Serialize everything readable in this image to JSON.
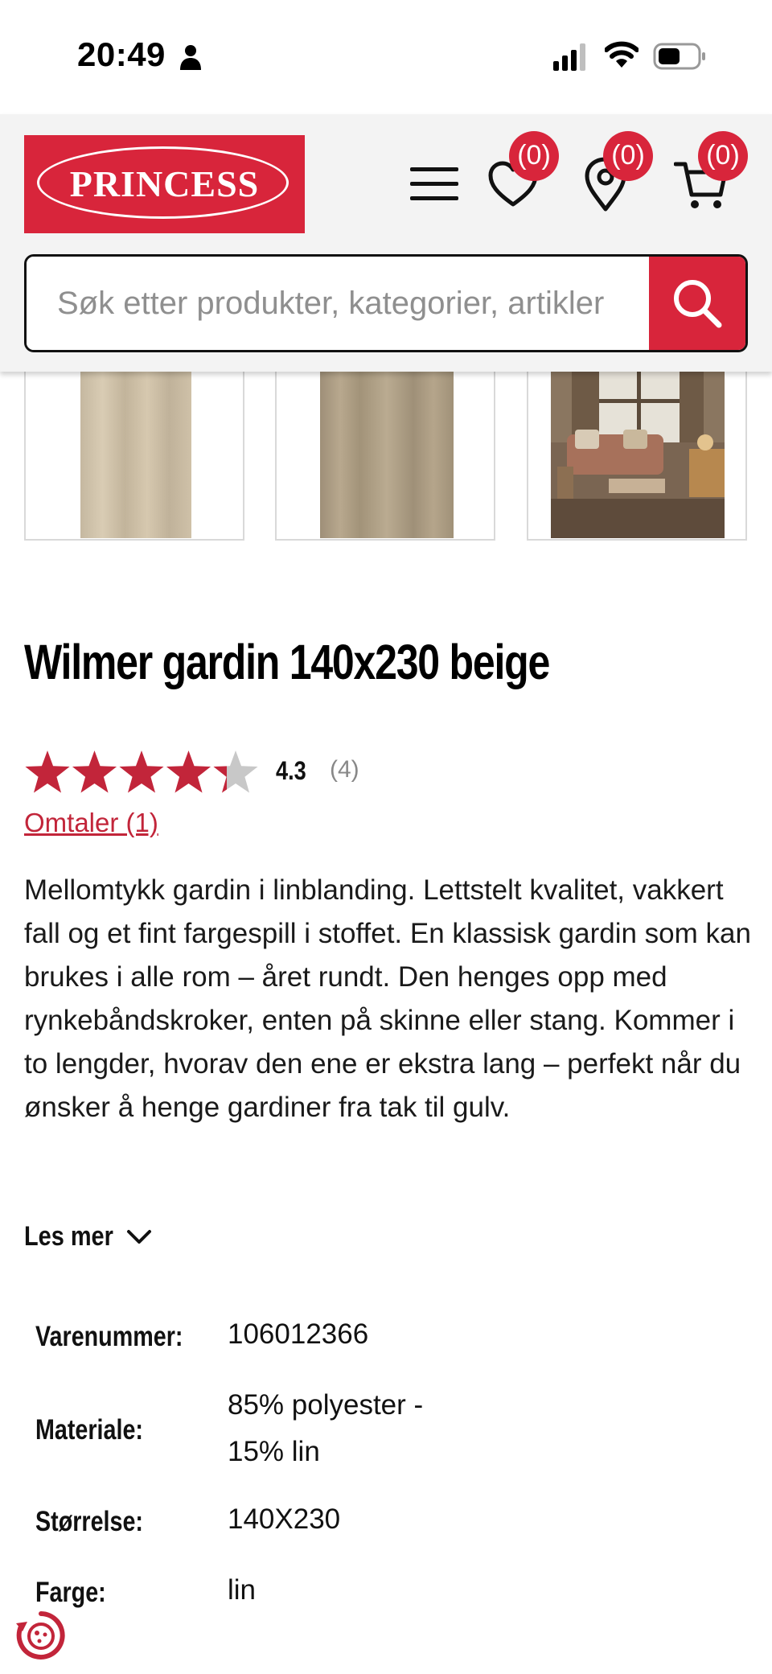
{
  "status_bar": {
    "time": "20:49"
  },
  "header": {
    "logo_text": "PRINCESS",
    "wishlist_count": "(0)",
    "stores_count": "(0)",
    "cart_count": "(0)",
    "accent_color": "#d8253b"
  },
  "search": {
    "placeholder": "Søk etter produkter, kategorier, artikler",
    "value": ""
  },
  "product": {
    "title": "Wilmer gardin 140x230 beige",
    "rating": {
      "value": "4.3",
      "count": "(4)",
      "stars": 4.3,
      "max_stars": 5
    },
    "reviews_link": "Omtaler (1)",
    "description": "Mellomtykk gardin i linblanding. Lettstelt kvalitet, vakkert fall og et fint fargespill i stoffet. En klassisk gardin som kan brukes i alle rom – året rundt. Den henges opp med rynkebåndskroker, enten på skinne eller stang. Kommer i to lengder, hvorav den ene er ekstra lang – perfekt når du ønsker å henge gardiner fra tak til gulv.",
    "read_more": "Les mer"
  },
  "specs": [
    {
      "label": "Varenummer:",
      "value": "106012366"
    },
    {
      "label": "Materiale:",
      "value": "85% polyester - 15% lin"
    },
    {
      "label": "Størrelse:",
      "value": "140X230"
    },
    {
      "label": "Farge:",
      "value": "lin"
    }
  ]
}
